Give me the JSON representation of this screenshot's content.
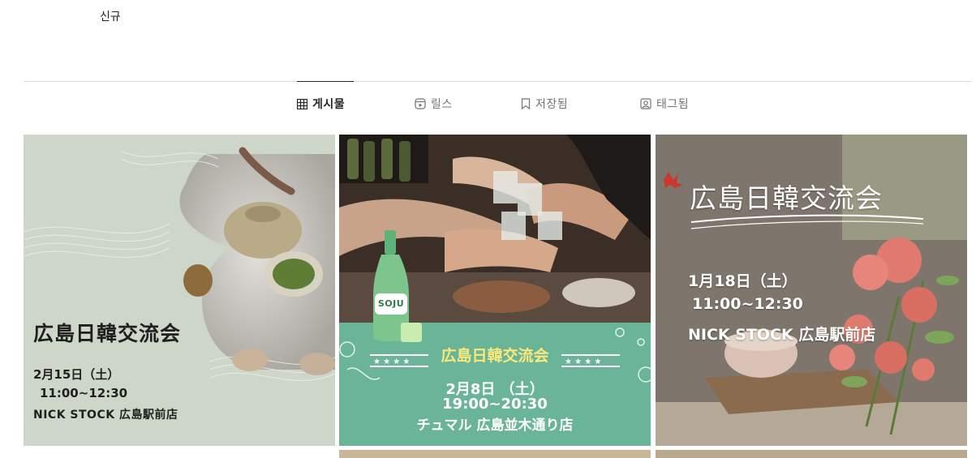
{
  "header": {
    "new_label": "신규"
  },
  "tabs": [
    {
      "label": "게시물",
      "icon": "grid-icon",
      "active": true
    },
    {
      "label": "릴스",
      "icon": "reels-icon",
      "active": false
    },
    {
      "label": "저장됨",
      "icon": "bookmark-icon",
      "active": false
    },
    {
      "label": "태그됨",
      "icon": "tagged-icon",
      "active": false
    }
  ],
  "posts": [
    {
      "title": "広島日韓交流会",
      "date": "2月15日（土）",
      "time": "11:00~12:30",
      "place": "NICK STOCK 広島駅前店"
    },
    {
      "badge": "SOJU",
      "title": "広島日韓交流会",
      "date": "2月8日 （土）",
      "time": "19:00~20:30",
      "place": "チュマル 広島並木通り店"
    },
    {
      "title": "広島日韓交流会",
      "date": "1月18日（土）",
      "time": "11:00~12:30",
      "place": "NICK STOCK 広島駅前店"
    }
  ],
  "colors": {
    "post1_bg": "#cdd6c8",
    "post2_band": "#6ab597",
    "post2_title": "#fbe87a",
    "post3_bg": "#8a8076"
  }
}
